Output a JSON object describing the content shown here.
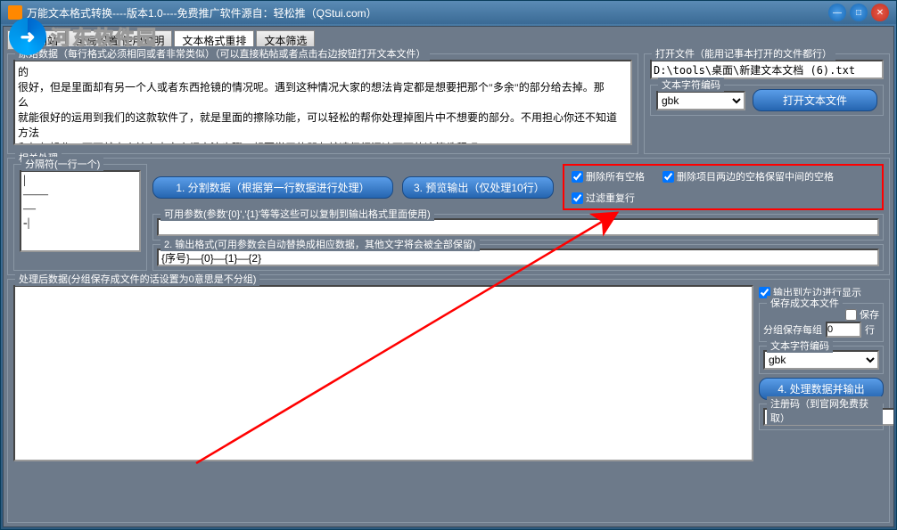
{
  "titlebar": {
    "title": "万能文本格式转换----版本1.0----免费推广软件源自：轻松推（QStui.com）"
  },
  "watermark": "河东软件园",
  "tabs": {
    "t1": "官方网站",
    "t2": "全局设置/使用说明",
    "t3": "文本格式重排",
    "t4": "文本筛选"
  },
  "raw": {
    "legend": "原始数据（每行格式必须相同或者非常类似）（可以直接粘帖或者点击右边按钮打开文本文件）",
    "text": "的\n很好，但是里面却有另一个人或者东西抢镜的情况呢。遇到这种情况大家的想法肯定都是想要把那个\"多余\"的部分给去掉。那\n么\n就能很好的运用到我们的这款软件了，就是里面的擦除功能，可以轻松的帮你处理掉图片中不想要的部分。不用担心你还不知道\n方法\n和如何操作，下面就由小编向大家介绍方法步骤。想要学习的朋友就请仔细阅读下面的这篇教程吧。"
  },
  "openfile": {
    "legend": "打开文件（能用记事本打开的文件都行）",
    "path": "D:\\tools\\桌面\\新建文本文档 (6).txt",
    "enc_legend": "文本字符编码",
    "encoding": "gbk",
    "btn": "打开文本文件"
  },
  "related": {
    "legend": "相关处理",
    "delim_legend": "分隔符(一行一个)",
    "delim": "|\n——\n—\n-|",
    "btn_split": "1. 分割数据（根据第一行数据进行处理）",
    "btn_preview": "3. 预览输出（仅处理10行）",
    "chk_trim_all": "删除所有空格",
    "chk_trim_sides": "删除项目两边的空格保留中间的空格",
    "chk_dedup": "过滤重复行",
    "params_legend": "可用参数(参数'{0}','{1}'等等这些可以复制到输出格式里面使用)",
    "params": "",
    "outfmt_legend": "2. 输出格式(可用参数会自动替换成相应数据，其他文字将会被全部保留)",
    "outfmt": "{序号}—{0}—{1}—{2}"
  },
  "processed": {
    "legend": "处理后数据(分组保存成文件的话设置为0意思是不分组)",
    "output": "",
    "chk_left": "输出到左边进行显示",
    "save_legend": "保存成文本文件",
    "save_chk": "保存",
    "group_label_a": "分组保存每组",
    "group_val": "0",
    "group_label_b": "行",
    "enc_legend": "文本字符编码",
    "encoding": "gbk",
    "btn_process": "4. 处理数据并输出",
    "reg_legend": "注册码（到官网免费获取）"
  }
}
